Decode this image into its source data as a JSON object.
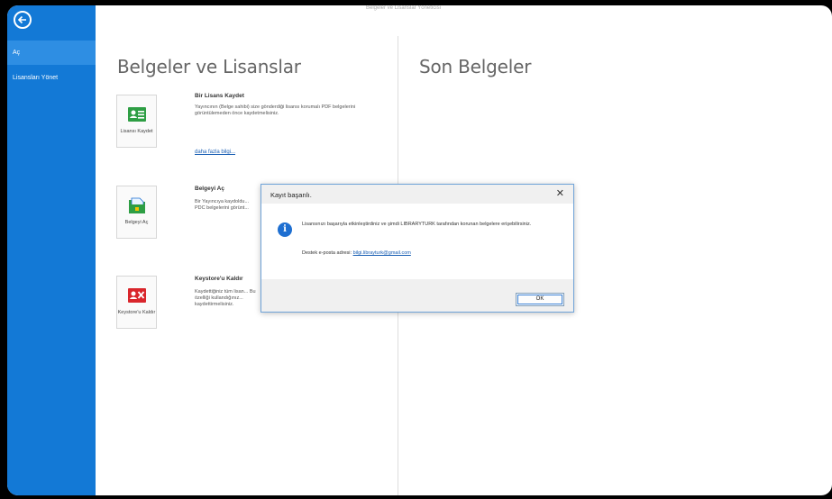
{
  "window": {
    "title": "Belgeler ve Lisanslar Yöneticisi"
  },
  "sidebar": {
    "items": [
      {
        "label": "Aç"
      },
      {
        "label": "Lisansları Yönet"
      }
    ]
  },
  "main": {
    "section_title": "Belgeler ve Lisanslar",
    "recent_title": "Son Belgeler",
    "actions": [
      {
        "tile_label": "Lisansı Kaydet",
        "heading": "Bir Lisans Kaydet",
        "description": "Yayıncının (Belge sahibi) size gönderdiği lisansı korumalı PDF belgelerini görüntülemeden önce kaydetmelisiniz.",
        "link": "daha fazla bilgi..."
      },
      {
        "tile_label": "Belgeyi Aç",
        "heading": "Belgeyi Aç",
        "description": "Bir Yayıncıya kaydoldu... PDC belgelerini görünt..."
      },
      {
        "tile_label": "Keystore'u Kaldır",
        "heading": "Keystore'u Kaldır",
        "description": "Kaydettiğiniz tüm lisan... Bu özelliği kullandığınız... kaydettirmelisiniz."
      }
    ]
  },
  "dialog": {
    "title": "Kayıt başarılı.",
    "message": "Lisansınızı başarıyla etkinleştirdiniz ve şimdi LIBRARYTURK tarafından korunan belgelere erişebilirsiniz.",
    "support_label": "Destek e-posta adresi:",
    "support_email": "bilgi.librayturk@gmail.com",
    "ok_label": "OK",
    "close_glyph": "✕",
    "info_glyph": "i"
  },
  "colors": {
    "sidebar": "#1379d6",
    "accent": "#1e6fd1"
  }
}
